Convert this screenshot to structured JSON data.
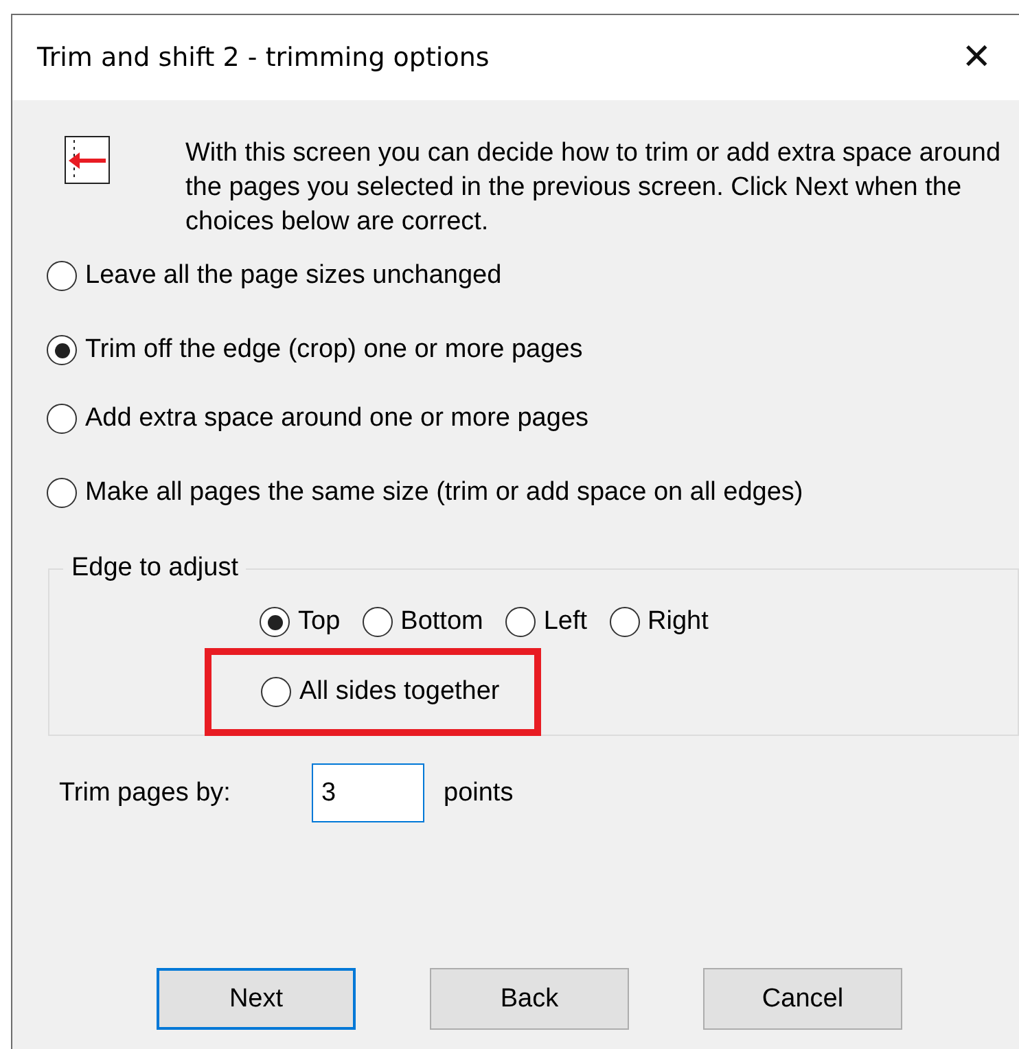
{
  "window": {
    "title": "Trim and shift 2 - trimming options",
    "close_glyph": "✕"
  },
  "intro": "With this screen you can decide how to trim or add extra space around the pages you selected in the previous screen. Click Next when the choices below are correct.",
  "modes": [
    {
      "label": "Leave all the page sizes unchanged",
      "selected": false
    },
    {
      "label": "Trim off the edge (crop) one or more pages",
      "selected": true
    },
    {
      "label": "Add extra space around one or more pages",
      "selected": false
    },
    {
      "label": "Make all pages the same size (trim or add space on all edges)",
      "selected": false
    }
  ],
  "edge_group": {
    "title": "Edge to adjust",
    "rows": [
      [
        {
          "label": "Top",
          "selected": true,
          "highlighted": false
        },
        {
          "label": "Bottom",
          "selected": false,
          "highlighted": false
        },
        {
          "label": "Left",
          "selected": false,
          "highlighted": false
        },
        {
          "label": "Right",
          "selected": false,
          "highlighted": false
        }
      ],
      [
        {
          "label": "All sides together",
          "selected": false,
          "highlighted": true
        }
      ]
    ]
  },
  "amount": {
    "label": "Trim pages by:",
    "value": "3",
    "unit": "points"
  },
  "buttons": [
    {
      "label": "Next",
      "default": true
    },
    {
      "label": "Back",
      "default": false
    },
    {
      "label": "Cancel",
      "default": false
    }
  ]
}
